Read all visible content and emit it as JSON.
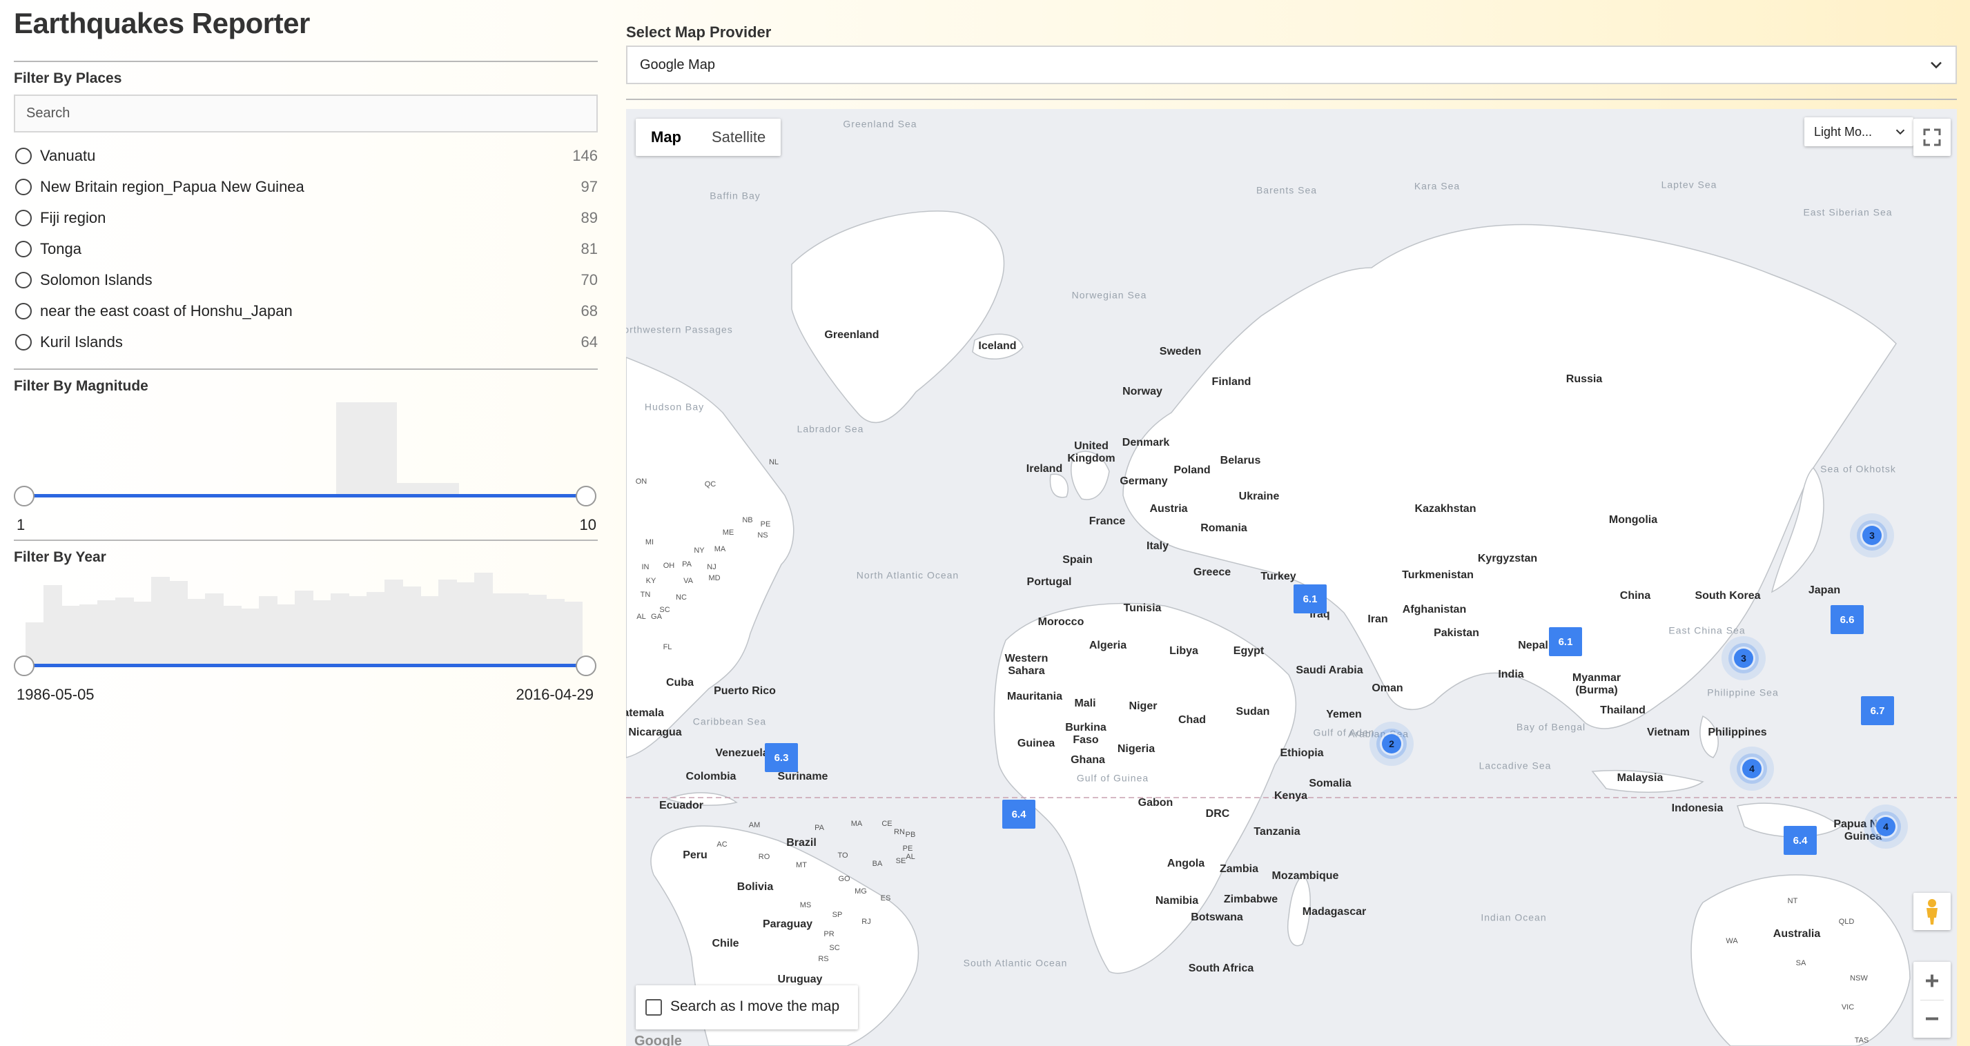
{
  "app": {
    "title": "Earthquakes Reporter"
  },
  "filters": {
    "places": {
      "title": "Filter By Places",
      "search_placeholder": "Search",
      "items": [
        {
          "label": "Vanuatu",
          "count": "146"
        },
        {
          "label": "New Britain region_Papua New Guinea",
          "count": "97"
        },
        {
          "label": "Fiji region",
          "count": "89"
        },
        {
          "label": "Tonga",
          "count": "81"
        },
        {
          "label": "Solomon Islands",
          "count": "70"
        },
        {
          "label": "near the east coast of Honshu_Japan",
          "count": "68"
        },
        {
          "label": "Kuril Islands",
          "count": "64"
        }
      ]
    },
    "magnitude": {
      "title": "Filter By Magnitude",
      "min_label": "1",
      "max_label": "10"
    },
    "year": {
      "title": "Filter By Year",
      "min_label": "1986-05-05",
      "max_label": "2016-04-29"
    }
  },
  "provider": {
    "label": "Select Map Provider",
    "selected": "Google Map"
  },
  "map": {
    "type_map": "Map",
    "type_satellite": "Satellite",
    "style_selected": "Light Mo...",
    "search_as_move": "Search as I move the map",
    "attribution": "Google",
    "countries": [
      "Greenland",
      "Iceland",
      "Sweden",
      "Finland",
      "Norway",
      "Russia",
      "United Kingdom",
      "Ireland",
      "Denmark",
      "Belarus",
      "Poland",
      "Germany",
      "Ukraine",
      "France",
      "Austria",
      "Romania",
      "Kazakhstan",
      "Mongolia",
      "Italy",
      "Spain",
      "Portugal",
      "Greece",
      "Turkey",
      "Turkmenistan",
      "Kyrgyzstan",
      "Iraq",
      "Iran",
      "Afghanistan",
      "Pakistan",
      "China",
      "South Korea",
      "Japan",
      "Nepal",
      "India",
      "Myanmar (Burma)",
      "Thailand",
      "Vietnam",
      "Philippines",
      "Malaysia",
      "Indonesia",
      "Papua New Guinea",
      "Australia",
      "Tunisia",
      "Morocco",
      "Algeria",
      "Libya",
      "Egypt",
      "Saudi Arabia",
      "Oman",
      "Yemen",
      "Western Sahara",
      "Mauritania",
      "Mali",
      "Niger",
      "Chad",
      "Sudan",
      "Burkina Faso",
      "Guinea",
      "Ghana",
      "Nigeria",
      "Ethiopia",
      "Somalia",
      "Gabon",
      "Kenya",
      "DRC",
      "Tanzania",
      "Angola",
      "Zambia",
      "Mozambique",
      "Namibia",
      "Zimbabwe",
      "Botswana",
      "Madagascar",
      "South Africa",
      "Cuba",
      "Puerto Rico",
      "Nicaragua",
      "Venezuela",
      "Colombia",
      "Suriname",
      "Ecuador",
      "Peru",
      "Brazil",
      "Bolivia",
      "Paraguay",
      "Chile",
      "Uruguay",
      "Guatemala"
    ],
    "oceans": [
      "North Atlantic Ocean",
      "South Atlantic Ocean",
      "Indian Ocean",
      "Greenland Sea",
      "Barents Sea",
      "Kara Sea",
      "Laptev Sea",
      "East Siberian Sea",
      "Norwegian Sea",
      "Baffin Bay",
      "Labrador Sea",
      "Hudson Bay",
      "Northwestern Passages",
      "Sea of Okhotsk",
      "Caribbean Sea",
      "Gulf of Guinea",
      "Arabian Sea",
      "Bay of Bengal",
      "Laccadive Sea",
      "Philippine Sea",
      "East China Sea",
      "Gulf of Aden"
    ],
    "states": [
      "ON",
      "QC",
      "NL",
      "NB",
      "PE",
      "NS",
      "ME",
      "MI",
      "NY",
      "PA",
      "MA",
      "OH",
      "IN",
      "NJ",
      "MD",
      "KY",
      "VA",
      "NC",
      "TN",
      "SC",
      "AL",
      "GA",
      "FL",
      "AM",
      "PA",
      "MA",
      "CE",
      "RN",
      "PB",
      "PE",
      "AL",
      "AC",
      "RO",
      "TO",
      "BA",
      "SE",
      "MT",
      "GO",
      "MG",
      "ES",
      "MS",
      "SP",
      "RJ",
      "PR",
      "SC",
      "RS",
      "NT",
      "QLD",
      "WA",
      "SA",
      "NSW",
      "VIC",
      "TAS"
    ],
    "markers": [
      {
        "label": "6.1",
        "kind": "square"
      },
      {
        "label": "6.1",
        "kind": "square"
      },
      {
        "label": "6.6",
        "kind": "square"
      },
      {
        "label": "6.7",
        "kind": "square"
      },
      {
        "label": "6.3",
        "kind": "square"
      },
      {
        "label": "6.4",
        "kind": "square"
      },
      {
        "label": "6.4",
        "kind": "square"
      },
      {
        "label": "3",
        "kind": "cluster"
      },
      {
        "label": "3",
        "kind": "cluster"
      },
      {
        "label": "2",
        "kind": "cluster"
      },
      {
        "label": "4",
        "kind": "cluster"
      },
      {
        "label": "4",
        "kind": "cluster"
      }
    ]
  },
  "colors": {
    "accent": "#2b66e0",
    "marker": "#3d82f0",
    "equator": "#c8a0b0"
  },
  "icons": [
    "chevron-down-icon",
    "fullscreen-icon",
    "pegman-icon",
    "zoom-in-icon",
    "zoom-out-icon"
  ]
}
